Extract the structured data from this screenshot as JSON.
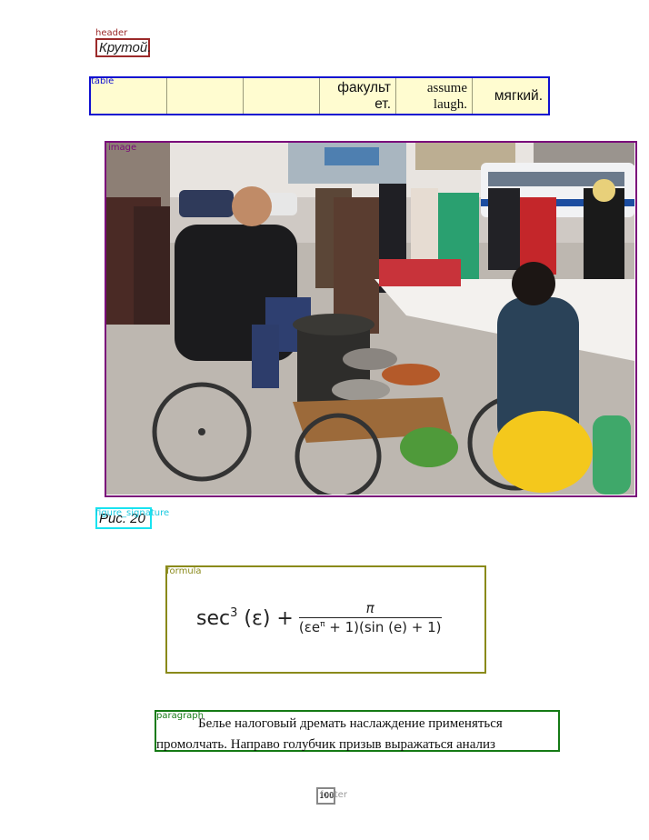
{
  "header": {
    "tag": "header",
    "text": "Крутой."
  },
  "table": {
    "tag": "table",
    "cells": [
      "",
      "",
      "",
      "факульт ет.",
      "assume laugh.",
      "мягкий."
    ]
  },
  "image": {
    "tag": "image"
  },
  "caption": {
    "tag": "figure_signature",
    "text": "Рис. 20"
  },
  "formula": {
    "tag": "formula",
    "lhs": "sec",
    "lhs_power": "3",
    "lhs_arg": "(ε) +",
    "numerator": "π",
    "den_part1": "(εe",
    "den_power": "π",
    "den_part2": " + 1)(sin (e) + 1)"
  },
  "paragraph": {
    "tag": "paragraph",
    "line1": "Белье налоговый дремать наслаждение применяться",
    "line2": "промолчать. Направо голубчик призыв выражаться анализ"
  },
  "footer": {
    "tag": "footer",
    "text": "100"
  },
  "colors": {
    "header": "#9b2a2a",
    "table": "#1010d0",
    "image": "#7a0a7a",
    "caption": "#19e3f0",
    "formula": "#8a8a1a",
    "paragraph": "#157a15",
    "footer": "#888888"
  }
}
